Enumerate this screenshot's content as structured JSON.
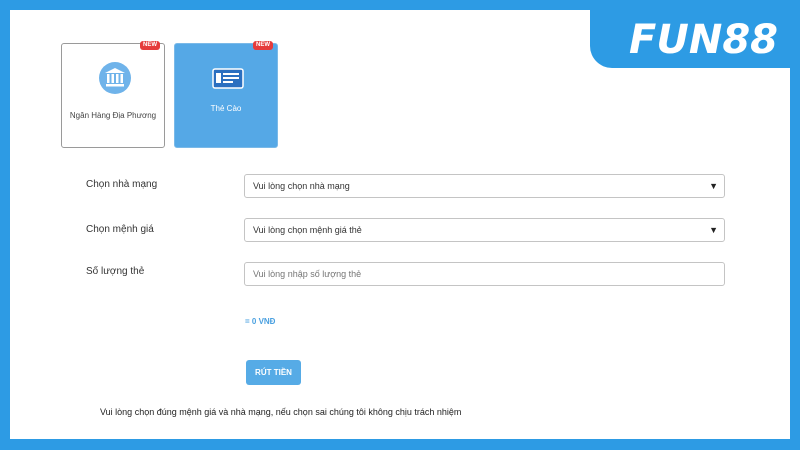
{
  "brand": {
    "logo_text": "FUN88"
  },
  "methods": [
    {
      "label": "Ngân Hàng Địa Phương",
      "badge": "NEW",
      "icon": "bank-icon",
      "selected": false
    },
    {
      "label": "Thẻ Cào",
      "badge": "NEW",
      "icon": "card-icon",
      "selected": true
    }
  ],
  "form": {
    "network": {
      "label": "Chọn nhà mạng",
      "value": "Vui lòng chọn nhà mạng"
    },
    "denomination": {
      "label": "Chọn mệnh giá",
      "value": "Vui lòng chọn mệnh giá thẻ"
    },
    "quantity": {
      "label": "Số lượng thẻ",
      "placeholder": "Vui lòng nhập số lượng thẻ"
    },
    "total": "= 0 VNĐ",
    "submit_label": "RÚT TIỀN"
  },
  "notice": "Vui lòng chọn đúng mệnh giá và nhà mạng, nếu chọn sai chúng tôi không chịu trách nhiệm",
  "colors": {
    "brand_blue": "#2d9be4",
    "card_selected": "#55a8e6",
    "badge_red": "#e53b3b"
  }
}
